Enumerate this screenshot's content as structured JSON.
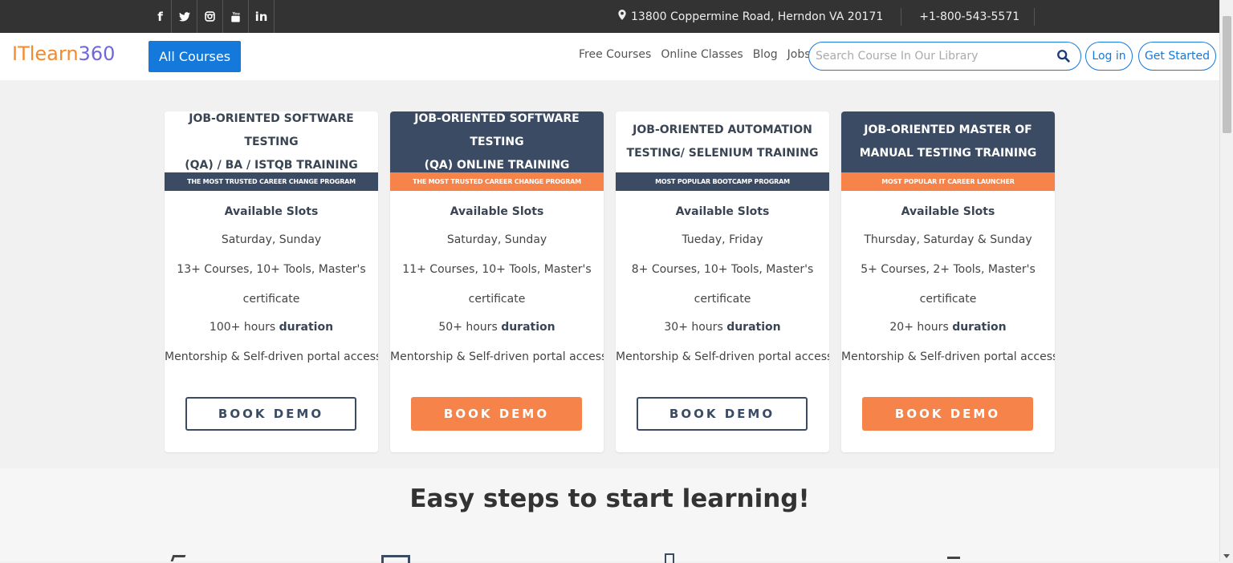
{
  "topbar": {
    "social": [
      {
        "name": "facebook-icon",
        "glyph": "f"
      },
      {
        "name": "twitter-icon",
        "glyph": "🐦"
      },
      {
        "name": "instagram-icon",
        "glyph": "◙"
      },
      {
        "name": "youtube-icon",
        "glyph": "▶"
      },
      {
        "name": "linkedin-icon",
        "glyph": "in"
      }
    ],
    "address": "13800 Coppermine Road, Herndon VA 20171",
    "phone": "+1-800-543-5571"
  },
  "navbar": {
    "logo_part1": "ITlearn",
    "logo_part2": "360",
    "all_courses": "All Courses",
    "links": [
      "Free Courses",
      "Online Classes",
      "Blog",
      "Jobs"
    ],
    "search_placeholder": "Search Course In Our Library",
    "login": "Log in",
    "get_started": "Get Started"
  },
  "colors": {
    "accent_blue": "#1479db",
    "navy": "#3b4b63",
    "orange": "#f6834a",
    "logo_orange": "#f48a2e",
    "logo_purple": "#6f68d8"
  },
  "cards": [
    {
      "title_line1": "JOB-ORIENTED SOFTWARE TESTING",
      "title_line2": "(QA) / BA / ISTQB TRAINING",
      "band": "THE MOST TRUSTED CAREER CHANGE PROGRAM",
      "slots_label": "Available Slots",
      "days": "Saturday, Sunday",
      "courses": "13+ Courses, 10+ Tools, Master's",
      "certificate": "certificate",
      "hours": "100+ hours",
      "duration": "duration",
      "mentorship": "Mentorship & Self-driven portal access",
      "button": "BOOK DEMO"
    },
    {
      "title_line1": "JOB-ORIENTED SOFTWARE TESTING",
      "title_line2": "(QA) ONLINE TRAINING",
      "band": "THE MOST TRUSTED CAREER CHANGE PROGRAM",
      "slots_label": "Available Slots",
      "days": "Saturday, Sunday",
      "courses": "11+ Courses, 10+ Tools, Master's",
      "certificate": "certificate",
      "hours": "50+ hours",
      "duration": "duration",
      "mentorship": "Mentorship & Self-driven portal access",
      "button": "BOOK DEMO"
    },
    {
      "title_line1": "JOB-ORIENTED AUTOMATION",
      "title_line2": "TESTING/ SELENIUM TRAINING",
      "band": "MOST POPULAR BOOTCAMP PROGRAM",
      "slots_label": "Available Slots",
      "days": "Tueday, Friday",
      "courses": "8+ Courses, 10+ Tools, Master's",
      "certificate": "certificate",
      "hours": "30+ hours",
      "duration": "duration",
      "mentorship": "Mentorship & Self-driven portal access",
      "button": "BOOK DEMO"
    },
    {
      "title_line1": "JOB-ORIENTED MASTER OF",
      "title_line2": "MANUAL TESTING TRAINING",
      "band": "MOST POPULAR IT CAREER LAUNCHER",
      "slots_label": "Available Slots",
      "days": "Thursday, Saturday & Sunday",
      "courses": "5+ Courses, 2+ Tools, Master's",
      "certificate": "certificate",
      "hours": "20+ hours",
      "duration": "duration",
      "mentorship": "Mentorship & Self-driven portal access",
      "button": "BOOK DEMO"
    }
  ],
  "steps": {
    "heading": "Easy steps to start learning!"
  }
}
